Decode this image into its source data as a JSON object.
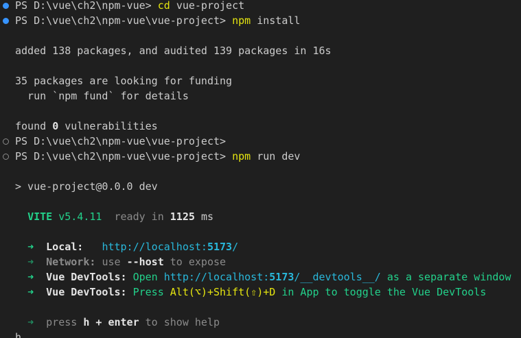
{
  "lines": {
    "l1_prompt": "PS D:\\vue\\ch2\\npm-vue>",
    "l1_cmd": "cd",
    "l1_arg": "vue-project",
    "l2_prompt": "PS D:\\vue\\ch2\\npm-vue\\vue-project>",
    "l2_cmd": "npm",
    "l2_arg": "install",
    "l3": "added 138 packages, and audited 139 packages in 16s",
    "l4": "35 packages are looking for funding",
    "l5": "  run `npm fund` for details",
    "l6_a": "found",
    "l6_b": "0",
    "l6_c": "vulnerabilities",
    "l7_prompt": "PS D:\\vue\\ch2\\npm-vue\\vue-project>",
    "l8_prompt": "PS D:\\vue\\ch2\\npm-vue\\vue-project>",
    "l8_cmd": "npm",
    "l8_arg": "run dev",
    "l9": "> vue-project@0.0.0 dev",
    "vite_name": "VITE",
    "vite_version": "v5.4.11",
    "vite_ready": "ready in",
    "vite_ms": "1125",
    "vite_unit": "ms",
    "arrow": "➜",
    "local_label": "Local:",
    "local_url_a": "http://localhost:",
    "local_url_port": "5173",
    "local_url_b": "/",
    "network_label": "Network:",
    "network_use": "use",
    "network_flag": "--host",
    "network_rest": "to expose",
    "devtools_label": "Vue DevTools:",
    "devtools1_open": "Open",
    "devtools1_url_a": "http://localhost:",
    "devtools1_port": "5173",
    "devtools1_url_b": "/__devtools__/",
    "devtools1_rest": "as a separate window",
    "devtools2_press": "Press",
    "devtools2_keys": "Alt(⌥)+Shift(⇧)+D",
    "devtools2_rest": "in App to toggle the Vue DevTools",
    "help_press": "press",
    "help_keys": "h + enter",
    "help_rest": "to show help",
    "last": "h"
  },
  "colors": {
    "background": "#1f1f1f",
    "text": "#cccccc",
    "command": "#e5e510",
    "green": "#23d18b",
    "cyan": "#29b8db",
    "dim": "#8b8b8b",
    "dot_active": "#3794ff"
  }
}
